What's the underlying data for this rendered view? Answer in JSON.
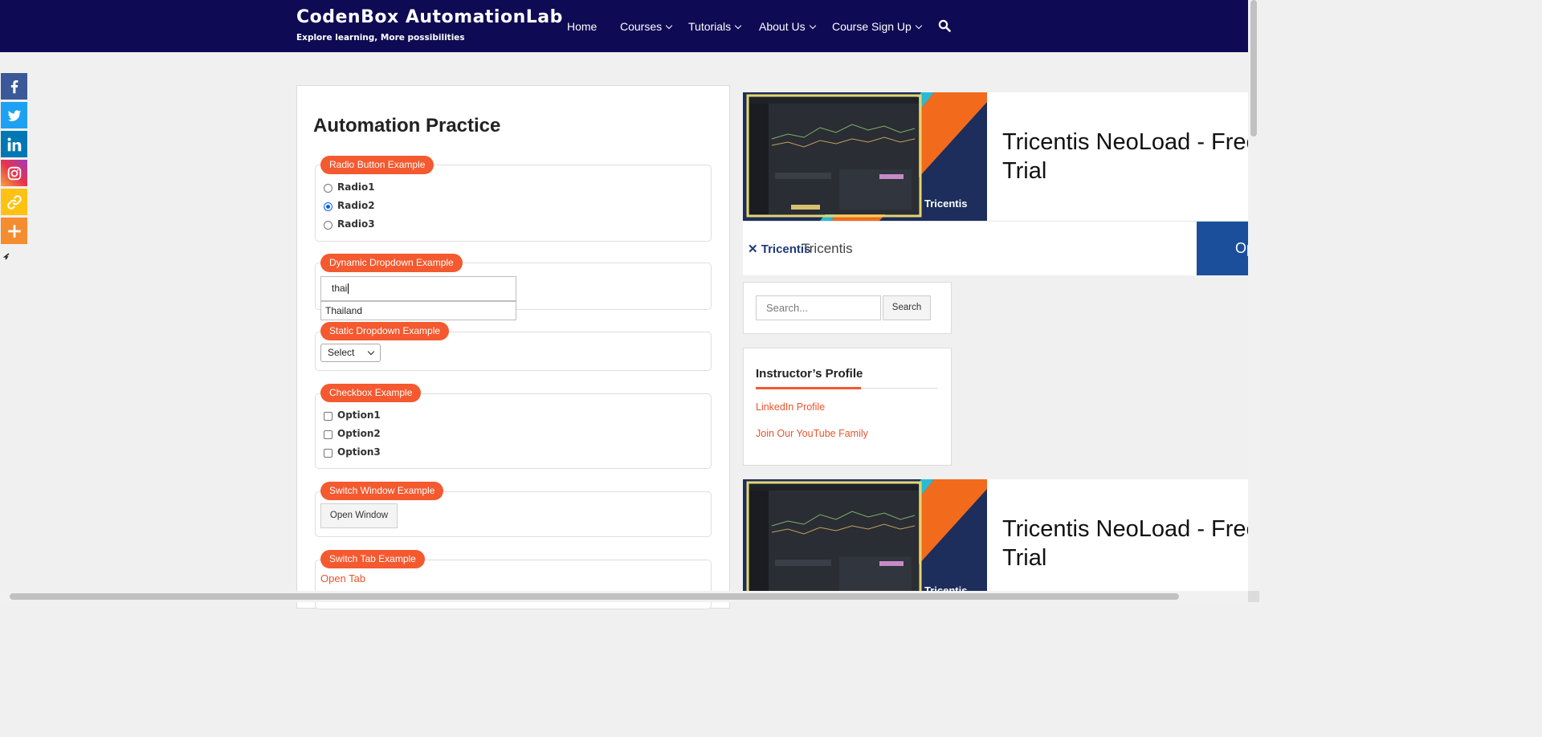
{
  "header": {
    "site_title": "CodenBox AutomationLab",
    "tagline": "Explore learning, More possibilities",
    "nav": [
      {
        "label": "Home"
      },
      {
        "label": "Courses"
      },
      {
        "label": "Tutorials"
      },
      {
        "label": "About Us"
      },
      {
        "label": "Course Sign Up"
      }
    ],
    "search_icon": "search-icon"
  },
  "social": [
    "facebook-icon",
    "twitter-icon",
    "linkedin-icon",
    "instagram-icon",
    "copy-link-icon",
    "more-icon"
  ],
  "main": {
    "title": "Automation Practice",
    "radio": {
      "legend": "Radio Button Example",
      "options": [
        "Radio1",
        "Radio2",
        "Radio3"
      ],
      "selected": "Radio2"
    },
    "dynamic_dropdown": {
      "legend": "Dynamic Dropdown Example",
      "value": "thai",
      "suggestion": "Thailand"
    },
    "static_dropdown": {
      "legend": "Static Dropdown Example",
      "selected": "Select"
    },
    "checkbox": {
      "legend": "Checkbox Example",
      "options": [
        "Option1",
        "Option2",
        "Option3"
      ]
    },
    "switch_window": {
      "legend": "Switch Window Example",
      "button": "Open Window"
    },
    "switch_tab": {
      "legend": "Switch Tab Example",
      "link": "Open Tab"
    }
  },
  "ads": {
    "title_line1": "Tricentis NeoLoad - Free",
    "title_line2": "Trial",
    "logo_text": "Tricentis",
    "brand": "Tricentis",
    "image_logo": "Tricentis",
    "open_button": "Open"
  },
  "sidebar": {
    "search_placeholder": "Search...",
    "search_button": "Search",
    "profile_title": "Instructor’s Profile",
    "links": [
      "LinkedIn Profile",
      "Join Our YouTube Family"
    ]
  },
  "colors": {
    "header_bg": "#0f0a54",
    "accent": "#f4592f",
    "link": "#e8552d"
  }
}
